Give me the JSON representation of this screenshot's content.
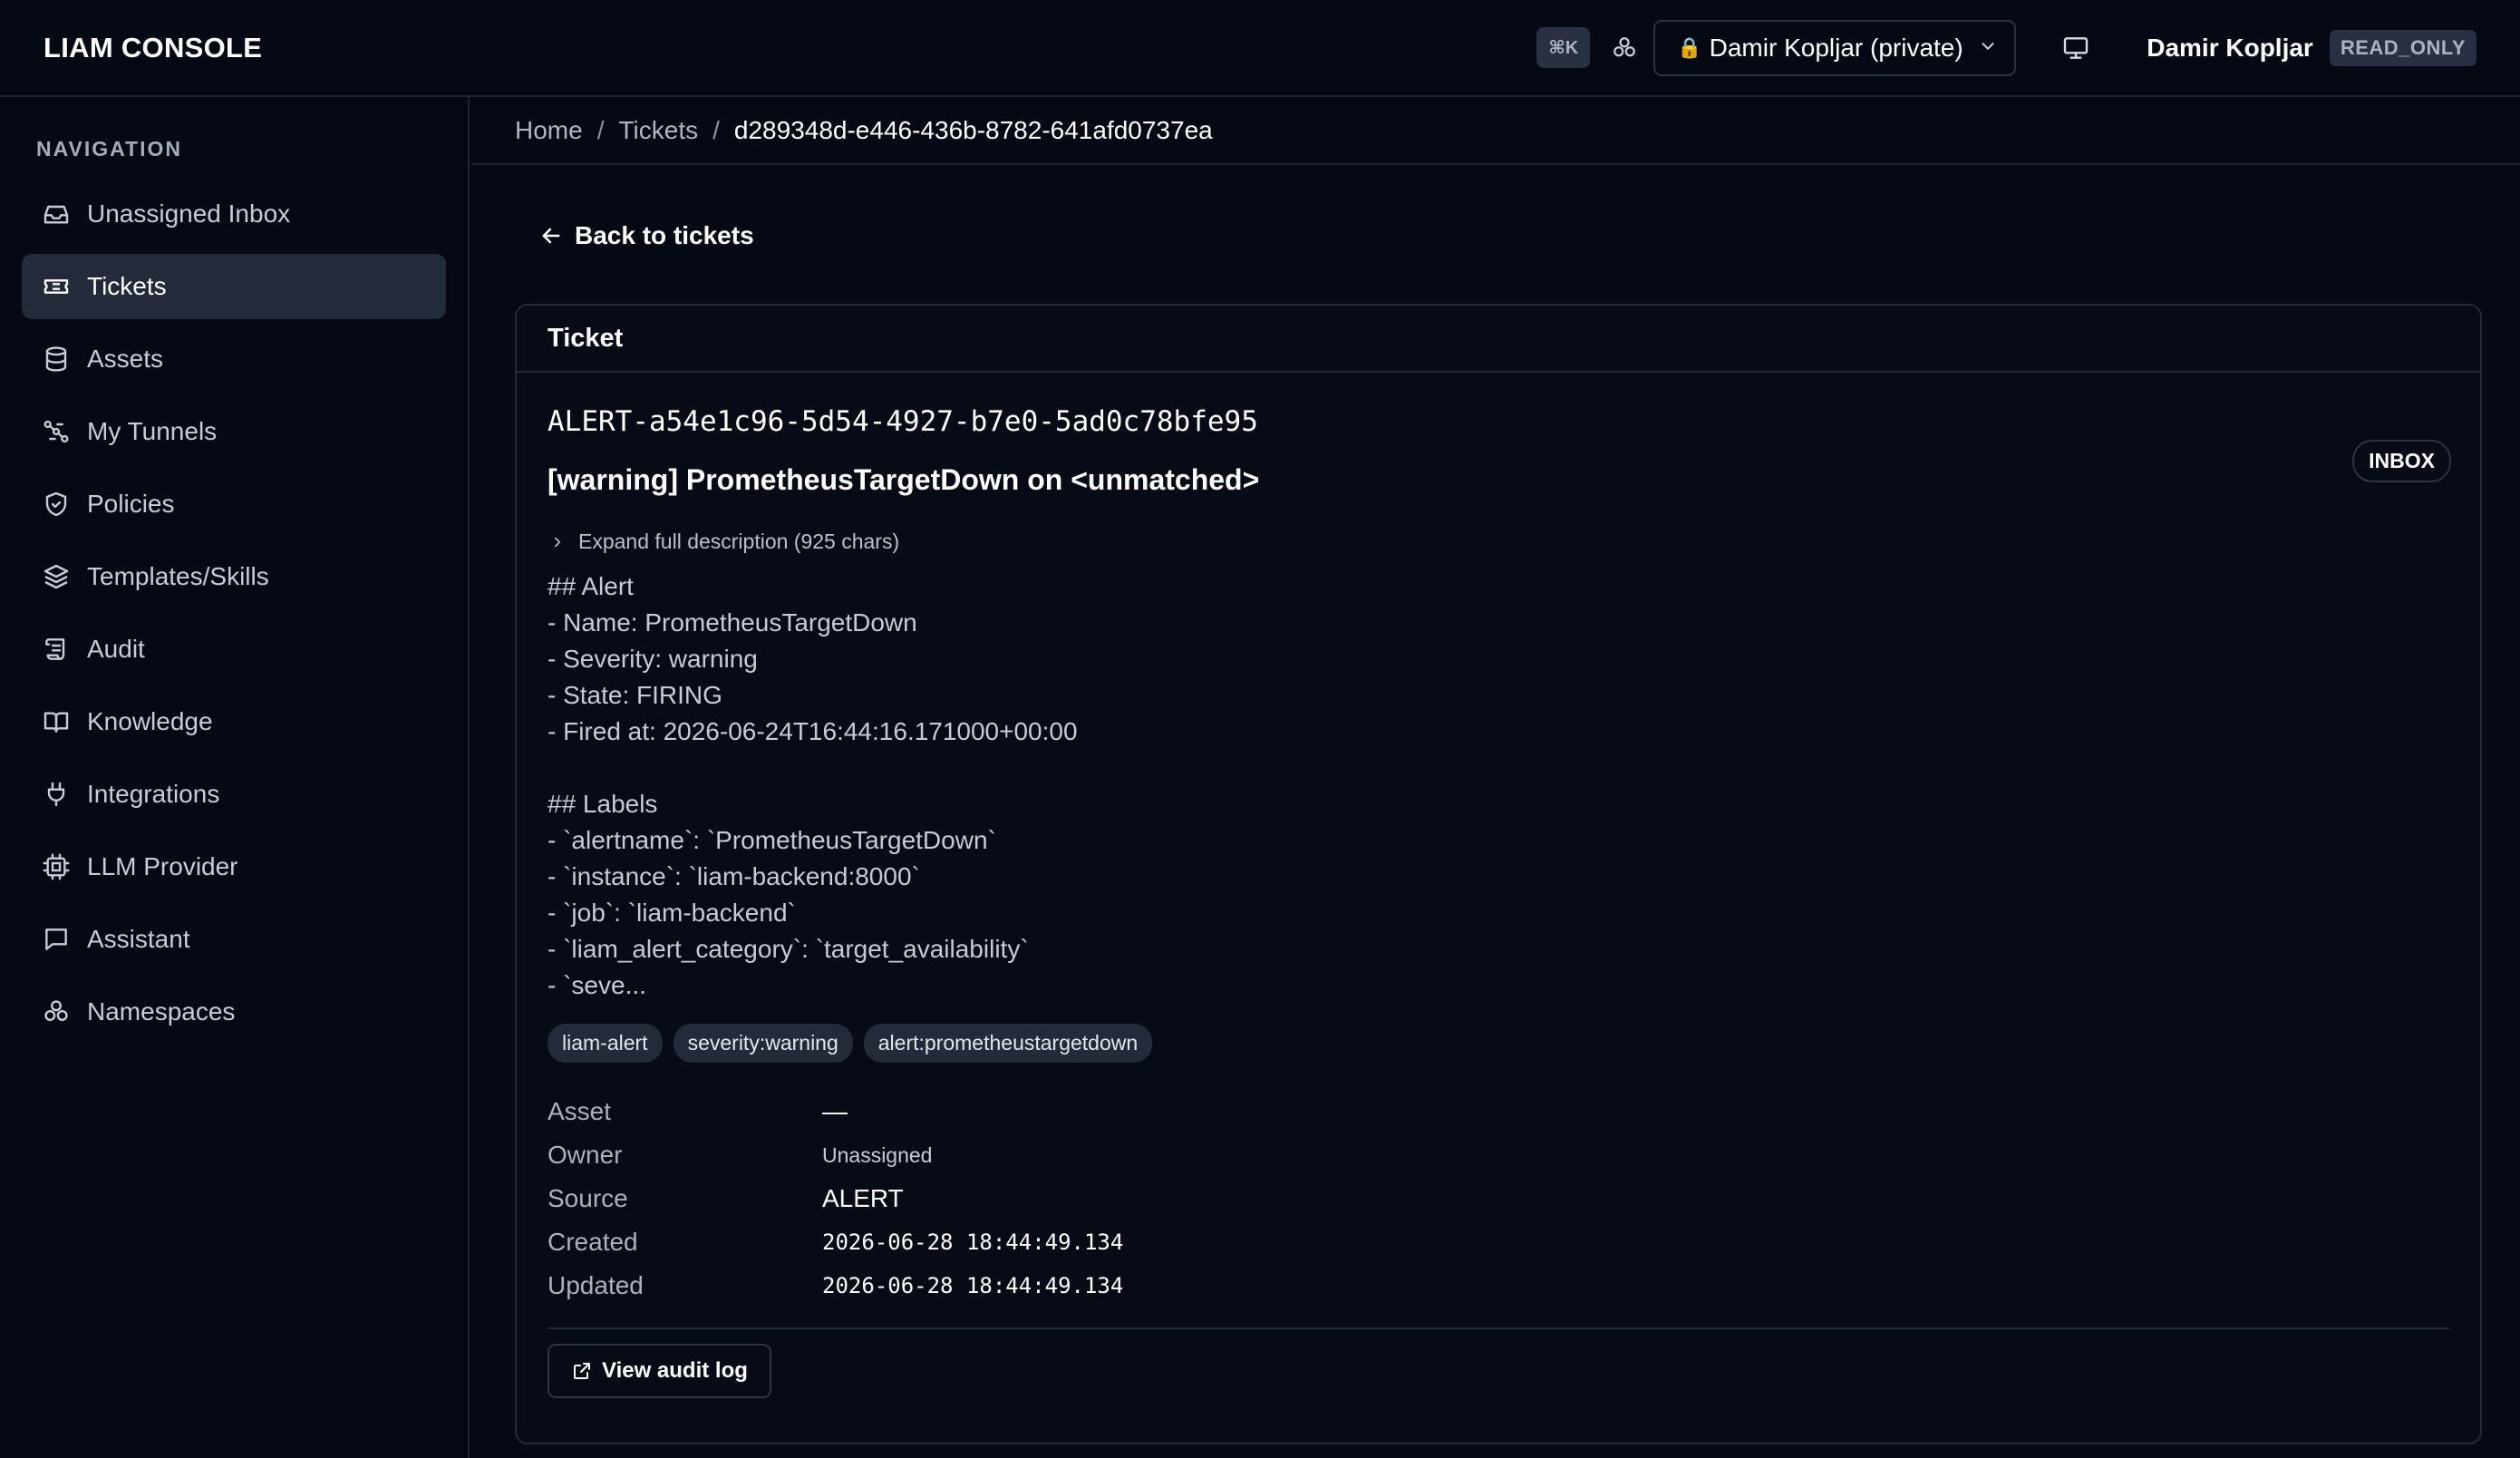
{
  "app": {
    "brand": "LIAM CONSOLE"
  },
  "header": {
    "shortcut": "⌘K",
    "namespace_label": "Damir Kopljar (private)",
    "user_name": "Damir Kopljar",
    "role": "READ_ONLY"
  },
  "sidebar": {
    "heading": "NAVIGATION",
    "items": [
      {
        "label": "Unassigned Inbox",
        "icon": "inbox-icon"
      },
      {
        "label": "Tickets",
        "icon": "ticket-icon"
      },
      {
        "label": "Assets",
        "icon": "database-icon"
      },
      {
        "label": "My Tunnels",
        "icon": "tunnel-icon"
      },
      {
        "label": "Policies",
        "icon": "shield-icon"
      },
      {
        "label": "Templates/Skills",
        "icon": "layers-icon"
      },
      {
        "label": "Audit",
        "icon": "scroll-icon"
      },
      {
        "label": "Knowledge",
        "icon": "book-icon"
      },
      {
        "label": "Integrations",
        "icon": "plug-icon"
      },
      {
        "label": "LLM Provider",
        "icon": "cpu-icon"
      },
      {
        "label": "Assistant",
        "icon": "chat-icon"
      },
      {
        "label": "Namespaces",
        "icon": "namespaces-icon"
      }
    ],
    "active": "Tickets"
  },
  "breadcrumb": {
    "home": "Home",
    "section": "Tickets",
    "current": "d289348d-e446-436b-8782-641afd0737ea",
    "separator": "/"
  },
  "main": {
    "back_label": "Back to tickets",
    "card_title": "Ticket",
    "ticket_id": "ALERT-a54e1c96-5d54-4927-b7e0-5ad0c78bfe95",
    "status": "INBOX",
    "title": "[warning] PrometheusTargetDown on <unmatched>",
    "expand_label": "Expand full description (925 chars)",
    "description_lines": [
      "## Alert",
      "- Name: PrometheusTargetDown",
      "- Severity: warning",
      "- State: FIRING",
      "- Fired at: 2026-06-24T16:44:16.171000+00:00",
      "",
      "## Labels",
      "- `alertname`: `PrometheusTargetDown`",
      "- `instance`: `liam-backend:8000`",
      "- `job`: `liam-backend`",
      "- `liam_alert_category`: `target_availability`",
      "- `seve..."
    ],
    "tags": [
      "liam-alert",
      "severity:warning",
      "alert:prometheustargetdown"
    ],
    "meta": {
      "asset_label": "Asset",
      "asset_value": "—",
      "owner_label": "Owner",
      "owner_value": "Unassigned",
      "source_label": "Source",
      "source_value": "ALERT",
      "created_label": "Created",
      "created_value": "2026-06-28 18:44:49.134",
      "updated_label": "Updated",
      "updated_value": "2026-06-28 18:44:49.134"
    },
    "audit_button": "View audit log"
  }
}
